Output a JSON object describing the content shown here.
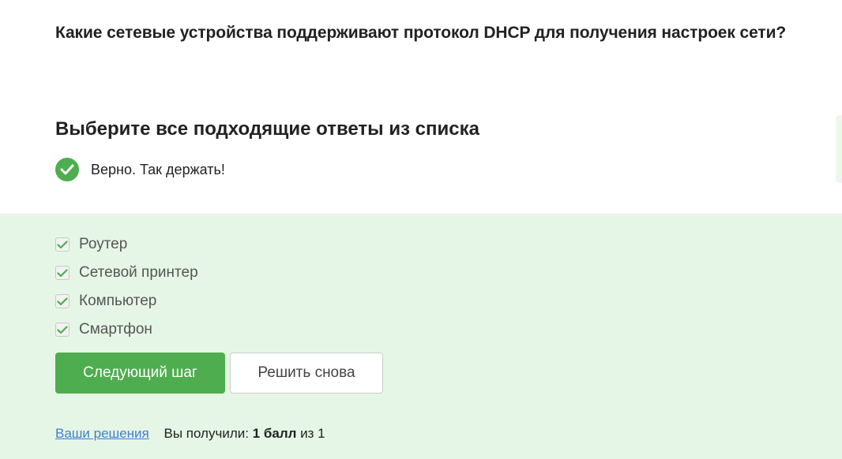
{
  "question": {
    "text": "Какие сетевые устройства поддерживают протокол DHCP для получения настроек сети?"
  },
  "instruction": "Выберите все подходящие ответы из списка",
  "feedback": {
    "icon": "check-circle-icon",
    "text": "Верно. Так держать!"
  },
  "options": [
    {
      "label": "Роутер",
      "checked": true
    },
    {
      "label": "Сетевой принтер",
      "checked": true
    },
    {
      "label": "Компьютер",
      "checked": true
    },
    {
      "label": "Смартфон",
      "checked": true
    }
  ],
  "buttons": {
    "next_label": "Следующий шаг",
    "retry_label": "Решить снова"
  },
  "footer": {
    "solutions_link": "Ваши решения",
    "score_prefix": "Вы получили:",
    "score_value": "1 балл",
    "score_suffix": "из 1"
  },
  "colors": {
    "accent": "#4ead4e",
    "panel": "#e6f6e6",
    "link": "#3d7fd0"
  }
}
